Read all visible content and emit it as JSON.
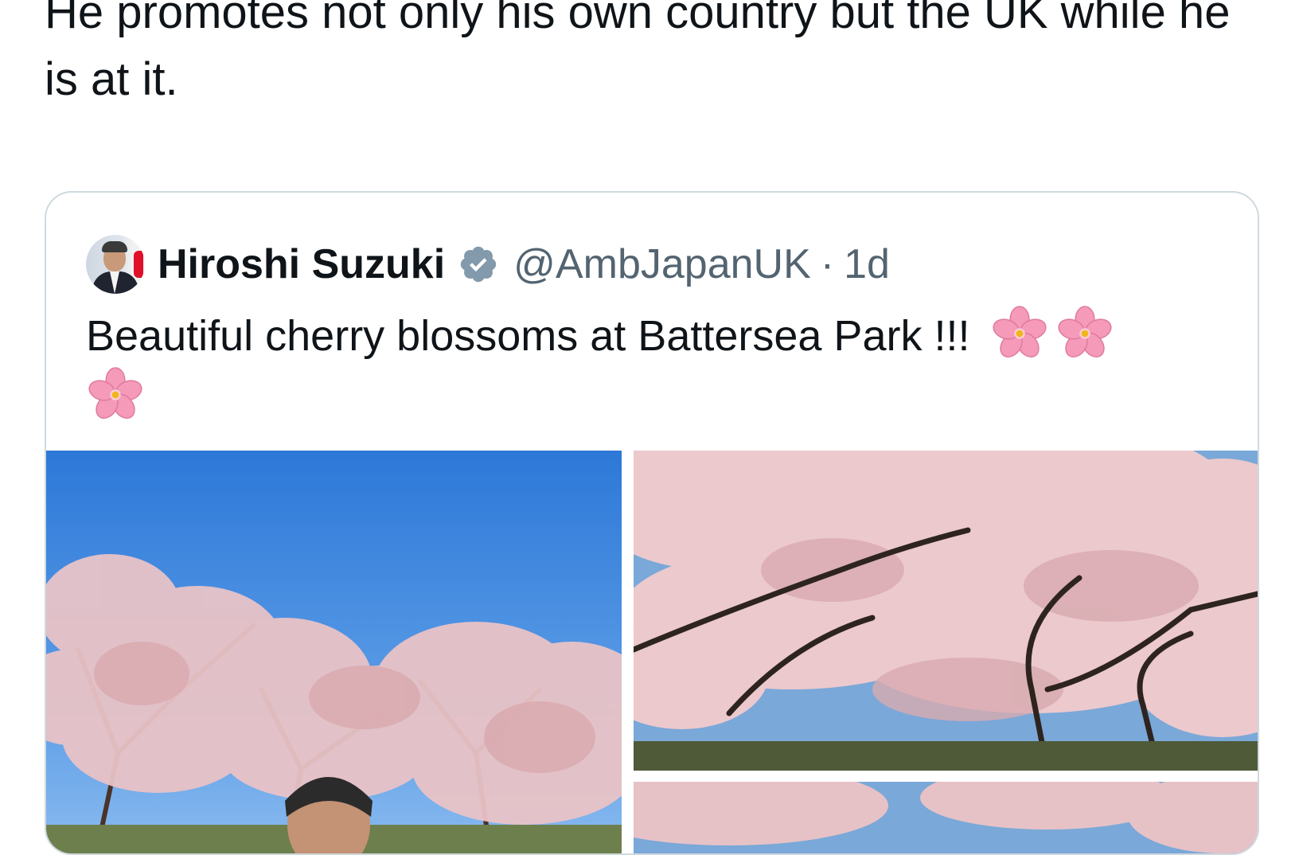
{
  "post": {
    "text": "He promotes not only his own country but the UK while he is at it."
  },
  "quote": {
    "display_name": "Hiroshi Suzuki",
    "handle": "@AmbJapanUK",
    "separator": "·",
    "time": "1d",
    "text": "Beautiful cherry blossoms at Battersea Park !!!",
    "emoji": "cherry-blossom-icon",
    "verified_color": "#829aab"
  },
  "photos": [
    {
      "name": "photo-ambassador-under-cherry-blossoms"
    },
    {
      "name": "photo-cherry-blossom-trees"
    },
    {
      "name": "photo-cherry-blossoms-third"
    }
  ]
}
